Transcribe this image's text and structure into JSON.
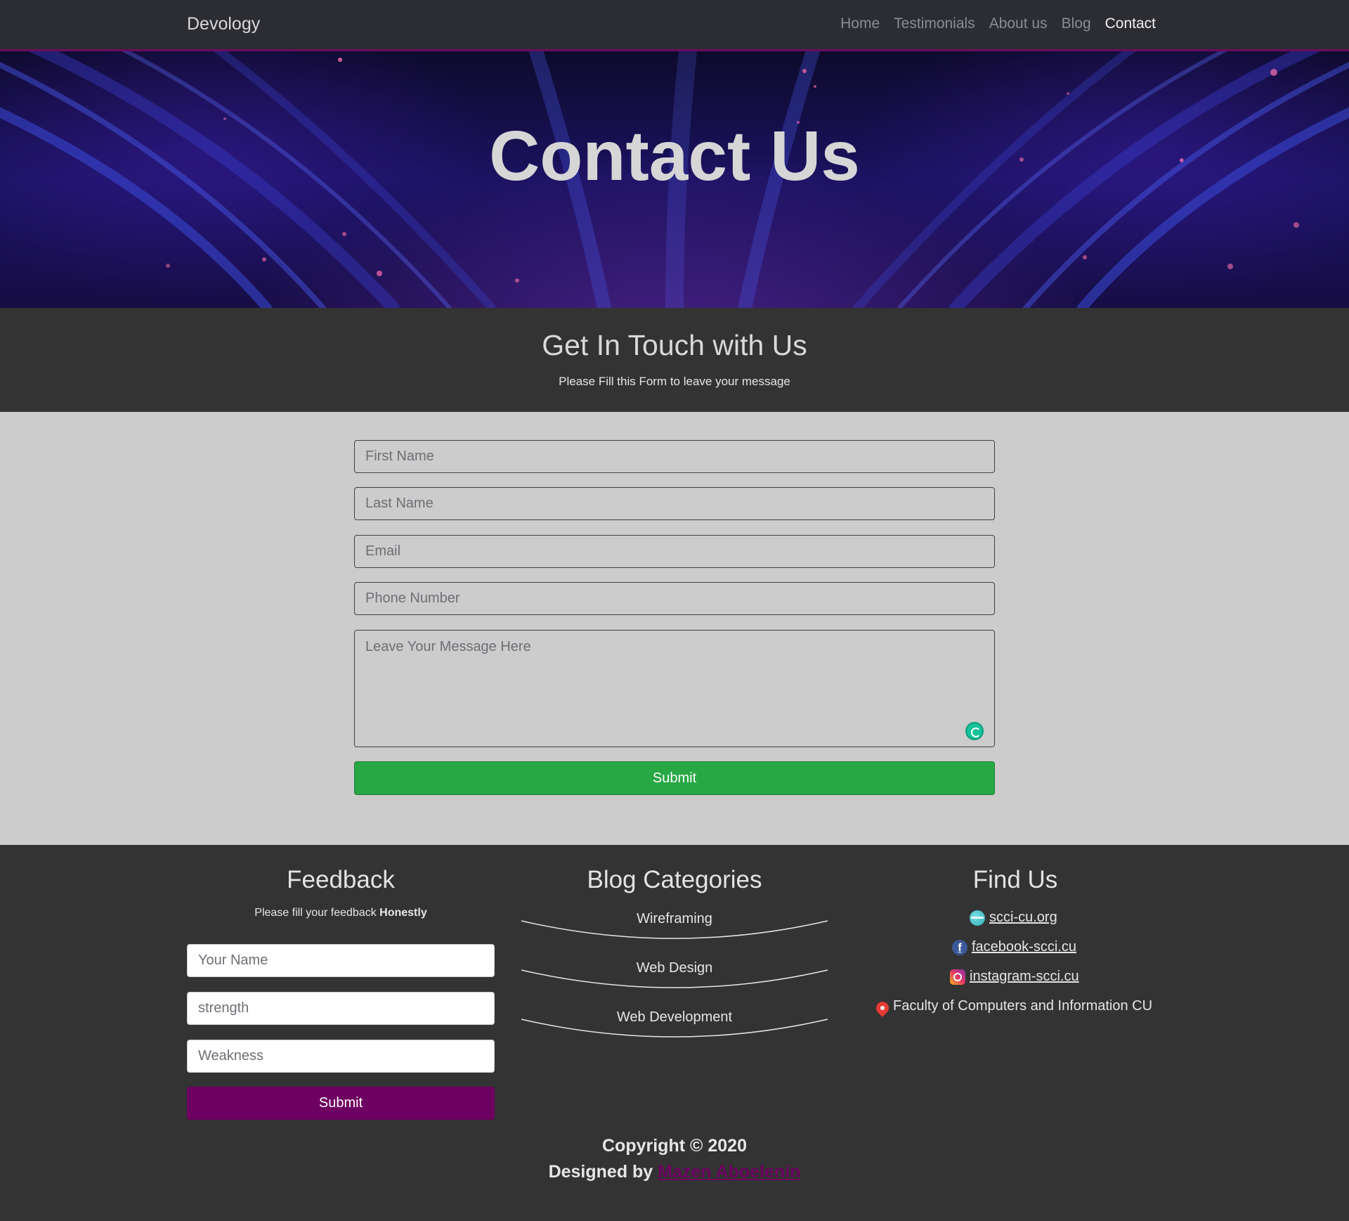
{
  "nav": {
    "brand": "Devology",
    "links": [
      "Home",
      "Testimonials",
      "About us",
      "Blog",
      "Contact"
    ],
    "active": "Contact"
  },
  "hero": {
    "title": "Contact Us"
  },
  "touch": {
    "heading": "Get In Touch with Us",
    "subtitle": "Please Fill this Form to leave your message"
  },
  "contact_form": {
    "first_name_placeholder": "First Name",
    "last_name_placeholder": "Last Name",
    "email_placeholder": "Email",
    "phone_placeholder": "Phone Number",
    "message_placeholder": "Leave Your Message Here",
    "submit_label": "Submit"
  },
  "feedback": {
    "title": "Feedback",
    "subtitle_prefix": "Please fill your feedback ",
    "subtitle_emphasis": "Honestly",
    "name_placeholder": "Your Name",
    "strength_placeholder": "strength",
    "weakness_placeholder": "Weakness",
    "submit_label": "Submit"
  },
  "blog_categories": {
    "title": "Blog Categories",
    "items": [
      "Wireframing",
      "Web Design",
      "Web Development"
    ]
  },
  "find_us": {
    "title": "Find Us",
    "items": [
      {
        "icon": "globe-icon",
        "text": "scci-cu.org"
      },
      {
        "icon": "facebook-icon",
        "text": "facebook-scci.cu"
      },
      {
        "icon": "instagram-icon",
        "text": "instagram-scci.cu"
      },
      {
        "icon": "location-pin-icon",
        "text": "Faculty of Computers and Information CU"
      }
    ]
  },
  "footer": {
    "copyright": "Copyright © 2020",
    "designed_prefix": "Designed by ",
    "designer": "Mazen Aboelenin"
  },
  "colors": {
    "nav_accent": "#6d0a5e",
    "submit_green": "#28a745",
    "feedback_purple": "#6d0060",
    "dark_bg": "#333333",
    "form_bg": "#cccccc"
  }
}
